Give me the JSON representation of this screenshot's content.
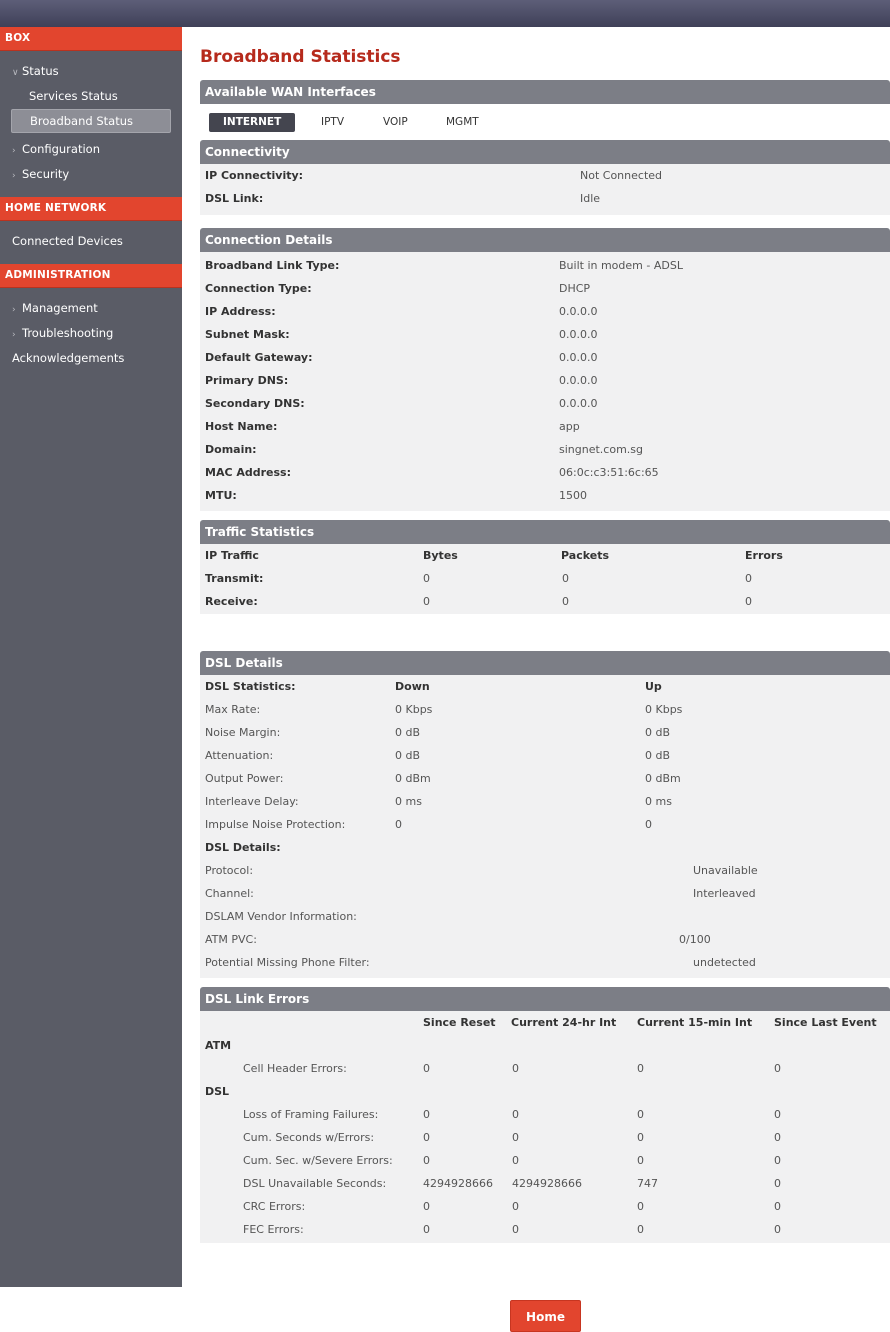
{
  "sidebar": {
    "box_header": "BOX",
    "status": "Status",
    "services_status": "Services Status",
    "broadband_status": "Broadband Status",
    "configuration": "Configuration",
    "security": "Security",
    "home_network_header": "HOME NETWORK",
    "connected_devices": "Connected Devices",
    "administration_header": "ADMINISTRATION",
    "management": "Management",
    "troubleshooting": "Troubleshooting",
    "acknowledgements": "Acknowledgements"
  },
  "page_title": "Broadband Statistics",
  "wan": {
    "title": "Available WAN Interfaces",
    "tabs": [
      "INTERNET",
      "IPTV",
      "VOIP",
      "MGMT"
    ],
    "active_tab": "INTERNET"
  },
  "connectivity": {
    "title": "Connectivity",
    "rows": [
      {
        "label": "IP Connectivity:",
        "value": "Not Connected"
      },
      {
        "label": "DSL Link:",
        "value": "Idle"
      }
    ]
  },
  "connection_details": {
    "title": "Connection Details",
    "rows": [
      {
        "label": "Broadband Link Type:",
        "value": "Built in modem - ADSL"
      },
      {
        "label": "Connection Type:",
        "value": "DHCP"
      },
      {
        "label": "IP Address:",
        "value": "0.0.0.0"
      },
      {
        "label": "Subnet Mask:",
        "value": "0.0.0.0"
      },
      {
        "label": "Default Gateway:",
        "value": "0.0.0.0"
      },
      {
        "label": "Primary DNS:",
        "value": "0.0.0.0"
      },
      {
        "label": "Secondary DNS:",
        "value": "0.0.0.0"
      },
      {
        "label": "Host Name:",
        "value": "app"
      },
      {
        "label": "Domain:",
        "value": "singnet.com.sg"
      },
      {
        "label": "MAC Address:",
        "value": "06:0c:c3:51:6c:65"
      },
      {
        "label": "MTU:",
        "value": "1500"
      }
    ]
  },
  "traffic": {
    "title": "Traffic Statistics",
    "headers": [
      "IP Traffic",
      "Bytes",
      "Packets",
      "Errors"
    ],
    "rows": [
      {
        "label": "Transmit:",
        "bytes": "0",
        "packets": "0",
        "errors": "0"
      },
      {
        "label": "Receive:",
        "bytes": "0",
        "packets": "0",
        "errors": "0"
      }
    ]
  },
  "dsl_details": {
    "title": "DSL Details",
    "stats_header": "DSL Statistics:",
    "down_header": "Down",
    "up_header": "Up",
    "stats": [
      {
        "label": "Max Rate:",
        "down": "0 Kbps",
        "up": "0 Kbps"
      },
      {
        "label": "Noise Margin:",
        "down": "0 dB",
        "up": "0 dB"
      },
      {
        "label": "Attenuation:",
        "down": "0 dB",
        "up": "0 dB"
      },
      {
        "label": "Output Power:",
        "down": "0 dBm",
        "up": "0 dBm"
      },
      {
        "label": "Interleave Delay:",
        "down": "0 ms",
        "up": "0 ms"
      },
      {
        "label": "Impulse Noise Protection:",
        "down": "0",
        "up": "0"
      }
    ],
    "details_header": "DSL Details:",
    "details": [
      {
        "label": "Protocol:",
        "value": "Unavailable"
      },
      {
        "label": "Channel:",
        "value": "Interleaved"
      },
      {
        "label": "DSLAM Vendor Information:",
        "value": ""
      },
      {
        "label": "ATM PVC:",
        "value": "0/100"
      },
      {
        "label": "Potential Missing Phone Filter:",
        "value": "undetected"
      }
    ]
  },
  "link_errors": {
    "title": "DSL Link Errors",
    "headers": [
      "Since Reset",
      "Current 24-hr Int",
      "Current 15-min Int",
      "Since Last Event"
    ],
    "atm_label": "ATM",
    "atm_rows": [
      {
        "label": "Cell Header Errors:",
        "values": [
          "0",
          "0",
          "0",
          "0"
        ]
      }
    ],
    "dsl_label": "DSL",
    "dsl_rows": [
      {
        "label": "Loss of Framing Failures:",
        "values": [
          "0",
          "0",
          "0",
          "0"
        ]
      },
      {
        "label": "Cum. Seconds w/Errors:",
        "values": [
          "0",
          "0",
          "0",
          "0"
        ]
      },
      {
        "label": "Cum. Sec. w/Severe Errors:",
        "values": [
          "0",
          "0",
          "0",
          "0"
        ]
      },
      {
        "label": "DSL Unavailable Seconds:",
        "values": [
          "4294928666",
          "4294928666",
          "747",
          "0"
        ]
      },
      {
        "label": "CRC Errors:",
        "values": [
          "0",
          "0",
          "0",
          "0"
        ]
      },
      {
        "label": "FEC Errors:",
        "values": [
          "0",
          "0",
          "0",
          "0"
        ]
      }
    ]
  },
  "home_button": "Home"
}
